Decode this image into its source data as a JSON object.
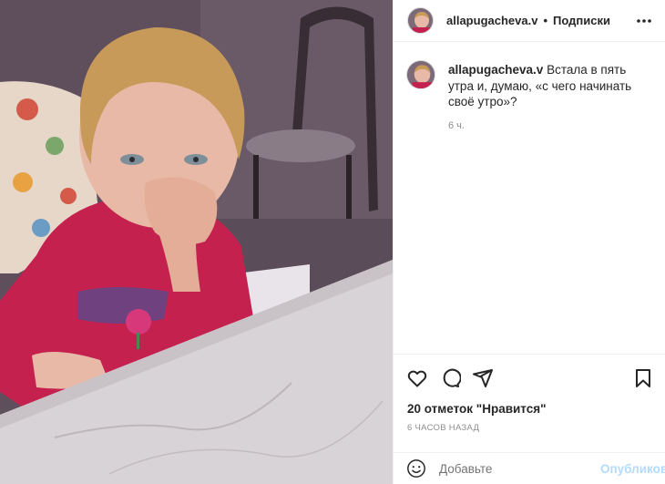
{
  "post": {
    "username": "allapugacheva.v",
    "separator": "•",
    "follow_label": "Подписки",
    "more_icon": "more-horizontal-icon"
  },
  "caption": {
    "username": "allapugacheva.v",
    "text": "Встала в пять утра и, думаю, «с чего начинать своё утро»?",
    "time": "6 ч."
  },
  "actions": {
    "like_icon": "heart-icon",
    "comment_icon": "comment-icon",
    "share_icon": "share-icon",
    "save_icon": "bookmark-icon"
  },
  "likes": "20 отметок \"Нравится\"",
  "time_ago": "6 часов назад",
  "comment": {
    "emoji_icon": "emoji-icon",
    "placeholder": "Добавьте",
    "publish_label": "Опубликовать"
  },
  "colors": {
    "text": "#262626",
    "secondary": "#8e8e8e",
    "border": "#efefef",
    "publish_disabled": "#b3dbff"
  }
}
